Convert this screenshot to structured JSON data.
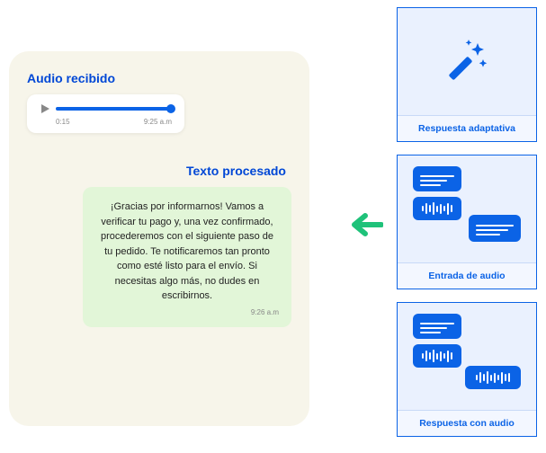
{
  "phone": {
    "audio_title": "Audio recibido",
    "audio_start": "0:15",
    "audio_end": "9:25 a.m",
    "processed_title": "Texto procesado",
    "message_body": "¡Gracias por informarnos! Vamos a verificar tu pago y, una vez confirmado, procederemos con el siguiente paso de tu pedido. Te notificaremos tan pronto como esté listo para el envío. Si necesitas algo más, no dudes en escribirnos.",
    "message_time": "9:26 a.m"
  },
  "features": {
    "adaptive": "Respuesta adaptativa",
    "audio_in": "Entrada de audio",
    "audio_out": "Respuesta con audio"
  },
  "colors": {
    "primary": "#0b63e6",
    "arrow": "#1fc27a"
  }
}
